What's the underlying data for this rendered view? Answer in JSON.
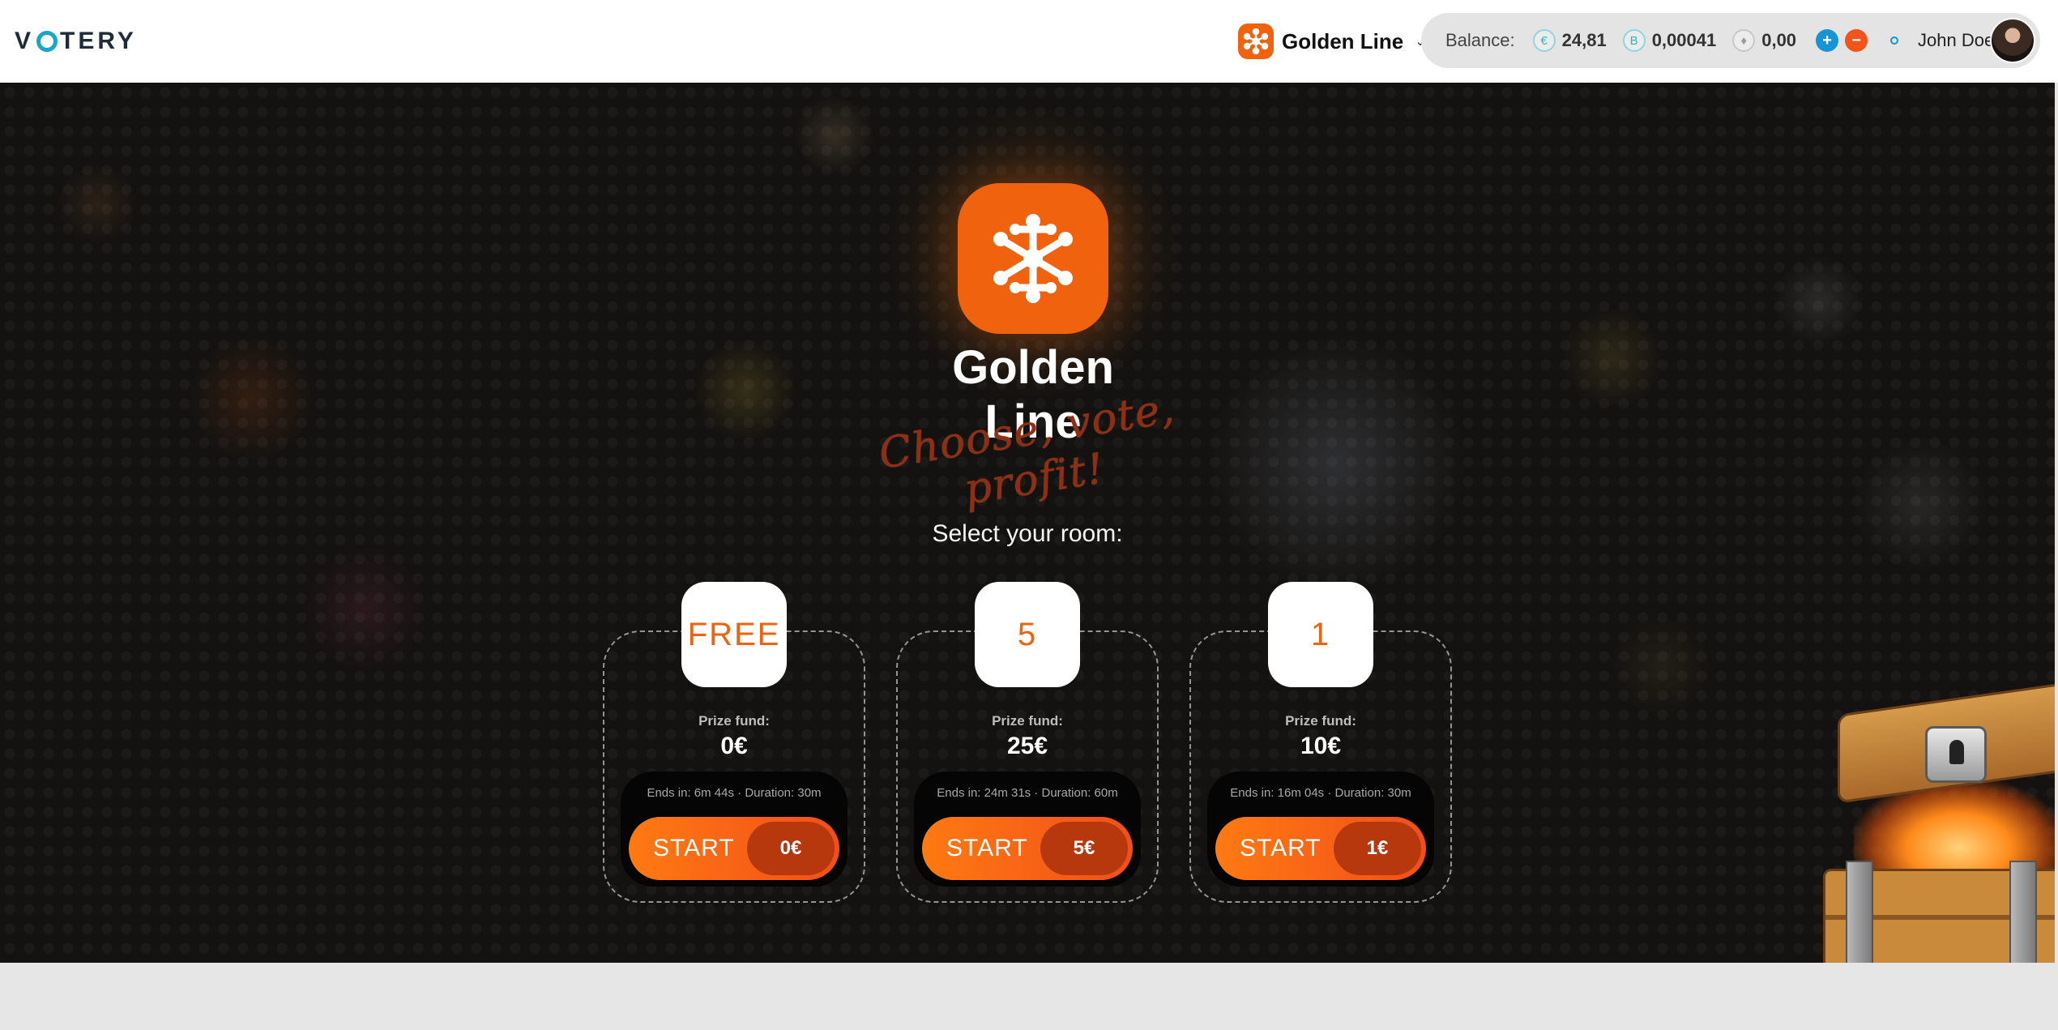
{
  "header": {
    "logo_text": "VOTERY",
    "game": {
      "name": "Golden Line",
      "icon": "molecule-icon"
    },
    "balance": {
      "label": "Balance:",
      "eur": {
        "symbol": "€",
        "value": "24,81"
      },
      "btc": {
        "symbol": "B",
        "value": "0,00041"
      },
      "eth": {
        "symbol": "♦",
        "value": "0,00"
      }
    },
    "deposit_symbol": "+",
    "withdraw_symbol": "−",
    "user_name": "John Doe"
  },
  "hero": {
    "title": "Golden Line",
    "tagline": "Choose, vote, profit!",
    "select_label": "Select your room:"
  },
  "rooms": [
    {
      "badge": "FREE",
      "prize_label": "Prize fund:",
      "prize": "0€",
      "timer": "Ends in: 6m 44s · Duration: 30m",
      "start_label": "START",
      "price": "0€"
    },
    {
      "badge": "5",
      "prize_label": "Prize fund:",
      "prize": "25€",
      "timer": "Ends in: 24m 31s · Duration: 60m",
      "start_label": "START",
      "price": "5€"
    },
    {
      "badge": "1",
      "prize_label": "Prize fund:",
      "prize": "10€",
      "timer": "Ends in: 16m 04s · Duration: 30m",
      "start_label": "START",
      "price": "1€"
    }
  ],
  "colors": {
    "accent": "#f0620e",
    "logo_ring": "#17a7c9",
    "plus": "#1794d6",
    "minus": "#f2541b"
  }
}
